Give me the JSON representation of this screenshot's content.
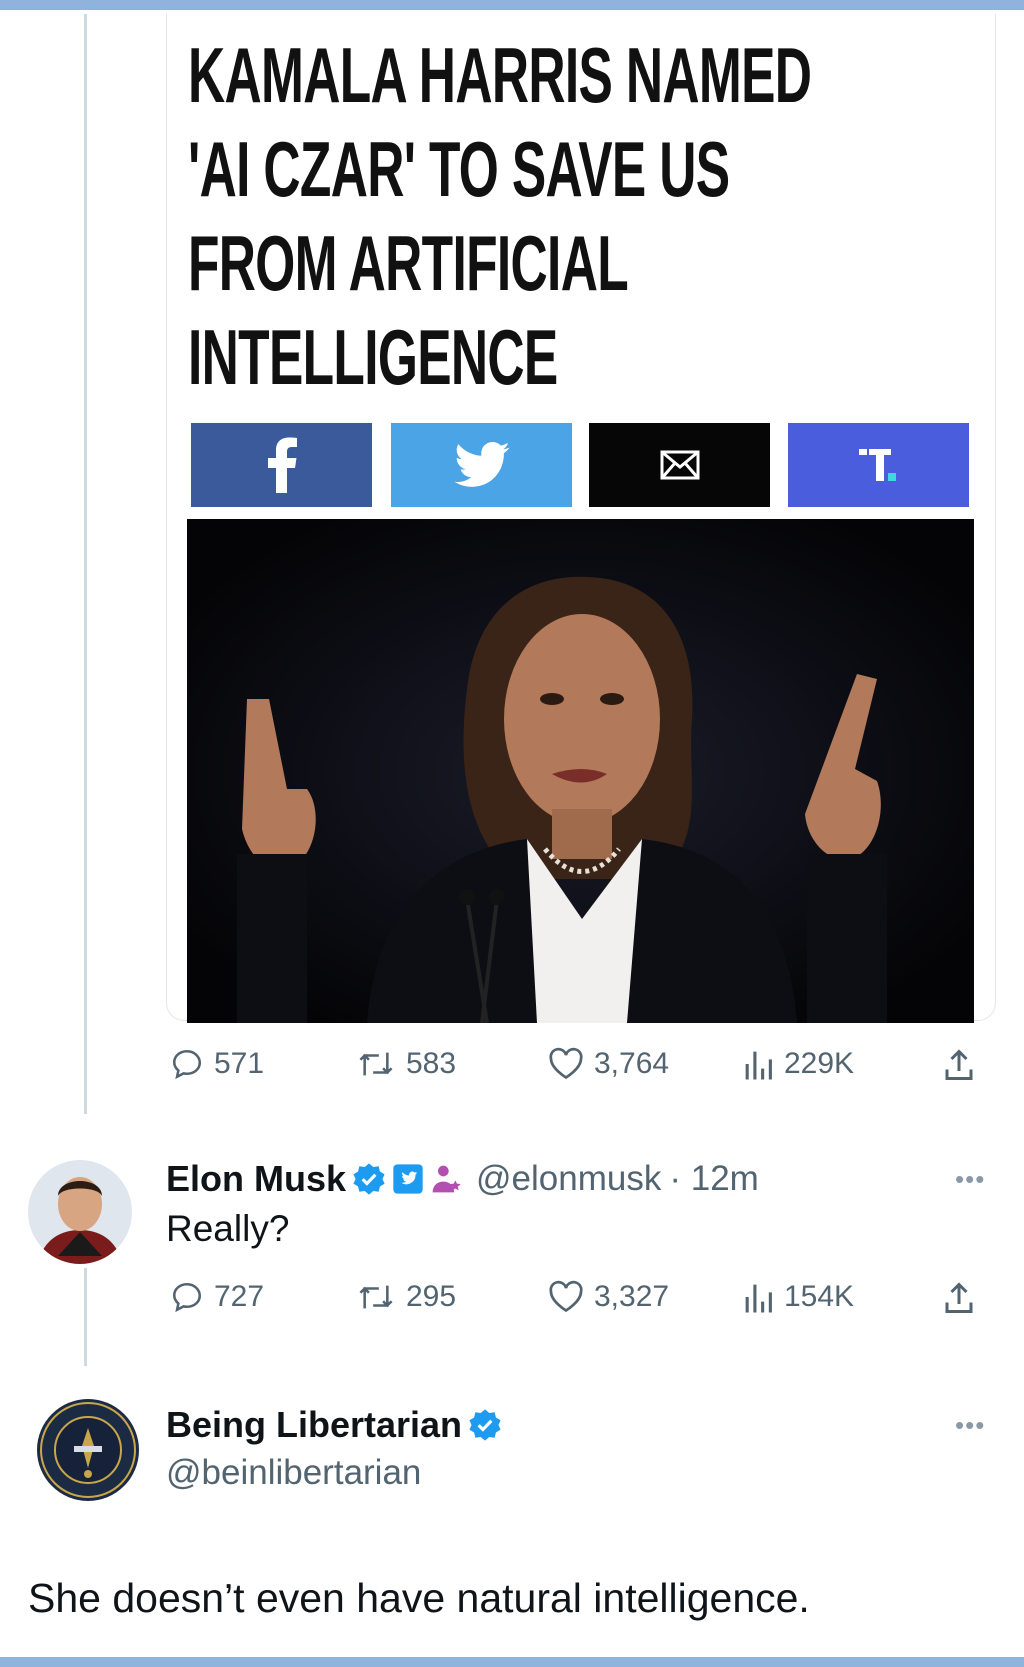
{
  "article": {
    "headline_lines": [
      "KAMALA HARRIS NAMED",
      "'AI CZAR' TO SAVE US",
      "FROM ARTIFICIAL",
      "INTELLIGENCE"
    ],
    "share_buttons": [
      {
        "name": "facebook",
        "icon": "facebook-icon",
        "color": "#3a5a9c"
      },
      {
        "name": "twitter",
        "icon": "twitter-bird-icon",
        "color": "#4aa4e6"
      },
      {
        "name": "email",
        "icon": "envelope-icon",
        "color": "#060606"
      },
      {
        "name": "truth-social",
        "icon": "truth-social-icon",
        "color": "#4a5ddc"
      }
    ]
  },
  "quoted_tweet_stats": {
    "replies": "571",
    "retweets": "583",
    "likes": "3,764",
    "views": "229K"
  },
  "reply_tweet": {
    "name": "Elon Musk",
    "handle": "@elonmusk",
    "time": "· 12m",
    "text": "Really?",
    "more": "•••",
    "stats": {
      "replies": "727",
      "retweets": "295",
      "likes": "3,327",
      "views": "154K"
    }
  },
  "second_reply": {
    "name": "Being Libertarian",
    "handle": "@beinlibertarian",
    "more": "•••",
    "text": "She doesn’t even have natural intelligence."
  },
  "colors": {
    "verified_blue": "#1d9bf0",
    "secondary_text": "#536471",
    "thread_line": "#cfd9de"
  }
}
